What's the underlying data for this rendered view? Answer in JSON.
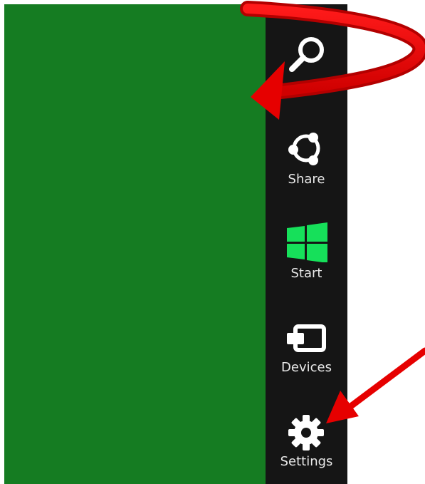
{
  "colors": {
    "app_background": "#157c22",
    "charms_background": "#151515",
    "charm_text": "#e9e9e9",
    "start_logo": "#16e05a",
    "annotation_arrow": "#e60000"
  },
  "charms": [
    {
      "label": "",
      "icon": "search-icon"
    },
    {
      "label": "Share",
      "icon": "share-icon"
    },
    {
      "label": "Start",
      "icon": "windows-logo-icon"
    },
    {
      "label": "Devices",
      "icon": "devices-icon"
    },
    {
      "label": "Settings",
      "icon": "gear-icon"
    }
  ]
}
